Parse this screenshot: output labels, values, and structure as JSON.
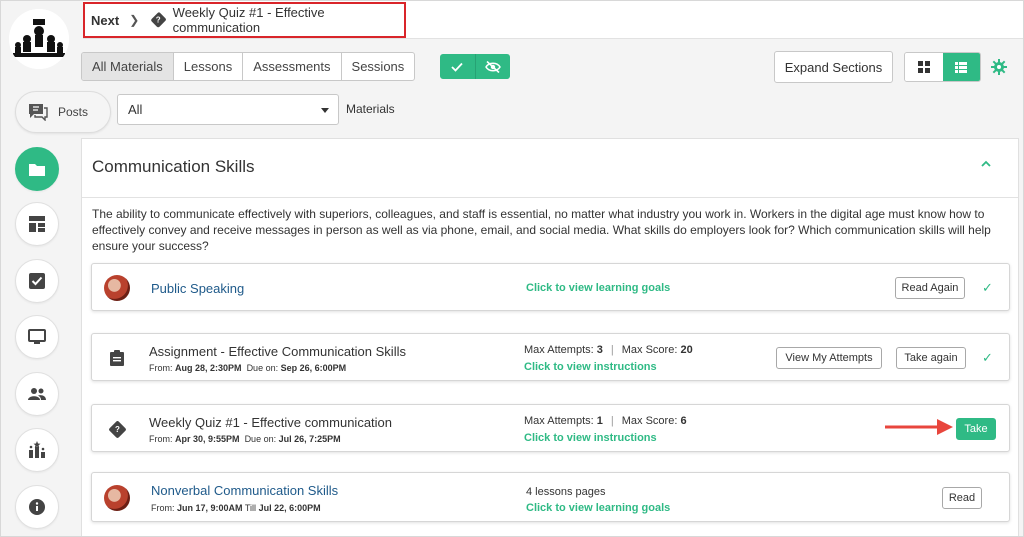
{
  "nav": {
    "next_label": "Next",
    "next_item_title": "Weekly Quiz #1 - Effective communication"
  },
  "tabs": [
    {
      "label": "All Materials",
      "active": true
    },
    {
      "label": "Lessons",
      "active": false
    },
    {
      "label": "Assessments",
      "active": false
    },
    {
      "label": "Sessions",
      "active": false
    }
  ],
  "toolbar": {
    "expand_label": "Expand Sections"
  },
  "posts": {
    "label": "Posts"
  },
  "filter": {
    "selected": "All",
    "label": "Materials"
  },
  "sidebar": {
    "items": [
      {
        "icon": "folder-icon",
        "active": true
      },
      {
        "icon": "dashboard-icon",
        "active": false
      },
      {
        "icon": "checkbox-icon",
        "active": false
      },
      {
        "icon": "monitor-icon",
        "active": false
      },
      {
        "icon": "people-icon",
        "active": false
      },
      {
        "icon": "leaderboard-icon",
        "active": false
      },
      {
        "icon": "info-icon",
        "active": false
      }
    ]
  },
  "section": {
    "title": "Communication Skills",
    "description": "The ability to communicate effectively with superiors, colleagues, and staff is essential, no matter what industry you work in. Workers in the digital age must know how to effectively convey and receive messages in person as well as via phone, email, and social media. What skills do employers look for? Which communication skills will help ensure your success?"
  },
  "materials": [
    {
      "title": "Public Speaking",
      "link": "Click to view learning goals",
      "button": "Read Again"
    },
    {
      "title": "Assignment - Effective Communication Skills",
      "from_label": "From:",
      "from": "Aug 28, 2:30PM",
      "due_label": "Due on:",
      "due": "Sep 26, 6:00PM",
      "attempts_label": "Max Attempts:",
      "attempts": "3",
      "score_label": "Max Score:",
      "score": "20",
      "link": "Click to view instructions",
      "button_secondary": "View My Attempts",
      "button": "Take again"
    },
    {
      "title": "Weekly Quiz #1 - Effective communication",
      "from_label": "From:",
      "from": "Apr 30, 9:55PM",
      "due_label": "Due on:",
      "due": "Jul 26, 7:25PM",
      "attempts_label": "Max Attempts:",
      "attempts": "1",
      "score_label": "Max Score:",
      "score": "6",
      "link": "Click to view instructions",
      "button": "Take"
    },
    {
      "title": "Nonverbal Communication Skills",
      "from_label": "From:",
      "from": "Jun 17, 9:00AM",
      "till_label": "Till",
      "till": "Jul 22, 6:00PM",
      "pages": "4 lessons pages",
      "link": "Click to view learning goals",
      "button": "Read"
    }
  ],
  "colors": {
    "accent": "#2fba85",
    "highlight": "#d9252a",
    "link": "#1f5a8a"
  }
}
